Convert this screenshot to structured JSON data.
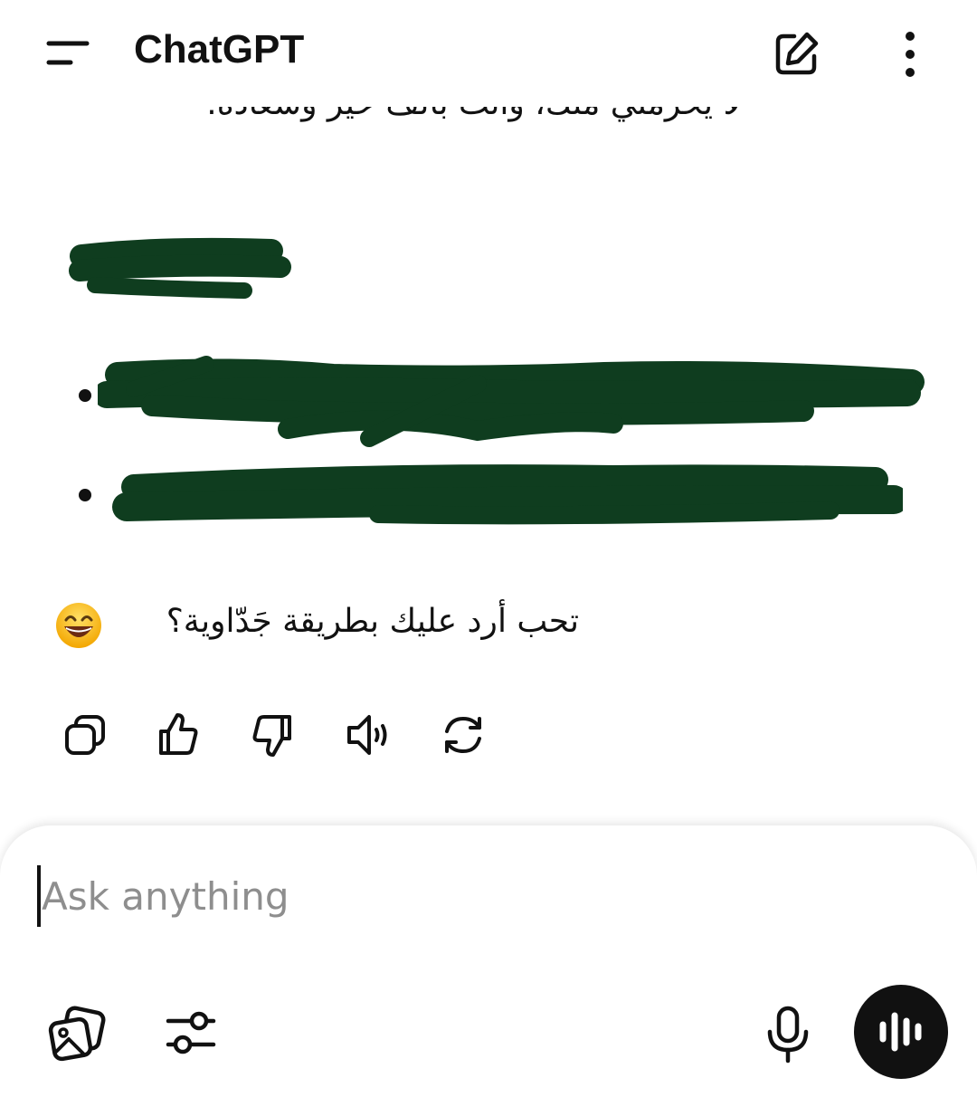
{
  "header": {
    "title": "ChatGPT",
    "icons": {
      "menu": "menu-icon",
      "new_chat": "edit-icon",
      "more": "more-vertical-icon"
    }
  },
  "message": {
    "partial_top_line": "لا يحرمني منك، وأنت بألف خير وسعادة.",
    "closing_question": "تحب أرد عليك بطريقة جَدّاوية؟",
    "emoji": "grinning-face-with-smiling-eyes",
    "redaction_color": "#0f3d1f"
  },
  "message_actions": [
    {
      "name": "copy",
      "icon": "copy-icon"
    },
    {
      "name": "good-response",
      "icon": "thumbs-up-icon"
    },
    {
      "name": "bad-response",
      "icon": "thumbs-down-icon"
    },
    {
      "name": "read-aloud",
      "icon": "speaker-icon"
    },
    {
      "name": "regenerate",
      "icon": "refresh-icon"
    }
  ],
  "composer": {
    "placeholder": "Ask anything",
    "value": "",
    "icons": {
      "attach": "image-attach-icon",
      "tools": "sliders-icon",
      "dictate": "microphone-icon",
      "voice": "voice-mode-icon"
    }
  },
  "colors": {
    "text": "#111111",
    "placeholder": "#8e8e8e",
    "background": "#ffffff",
    "voice_button": "#111111"
  }
}
